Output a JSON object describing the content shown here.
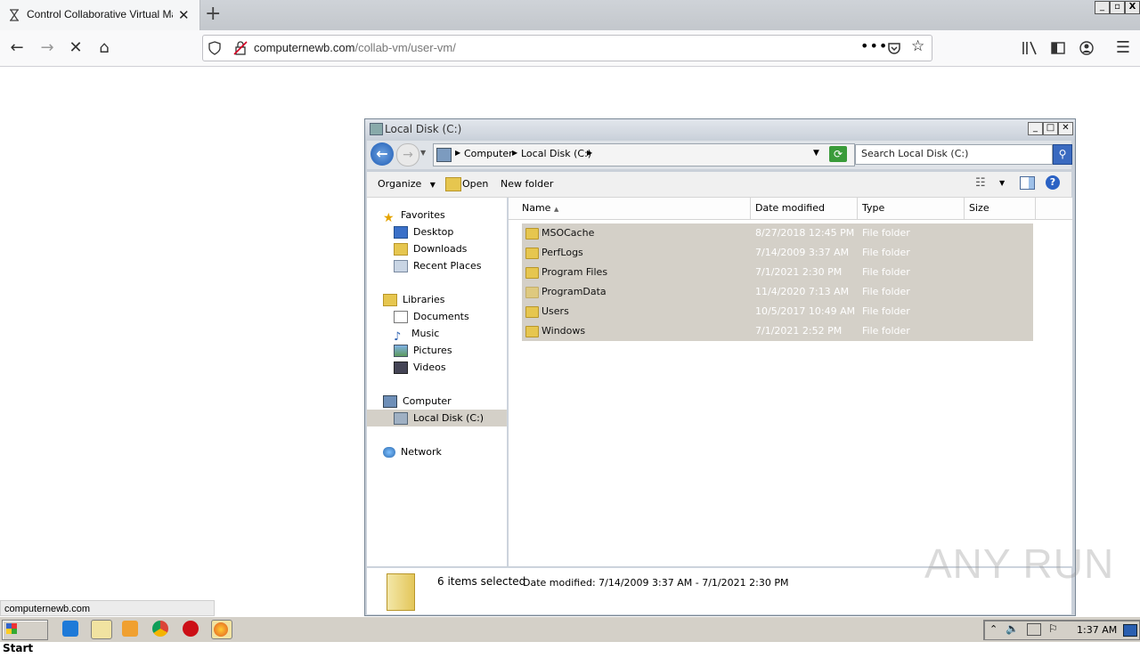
{
  "browser": {
    "tab_title": "Control Collaborative Virtual Machi",
    "url_host": "computernewb.com",
    "url_path": "/collab-vm/user-vm/",
    "status_link": "computernewb.com",
    "window_controls": [
      "_",
      "▫",
      "X"
    ]
  },
  "explorer": {
    "window_title": "Local Disk (C:)",
    "breadcrumb": [
      "Computer",
      "Local Disk (C:)"
    ],
    "search_placeholder": "Search Local Disk (C:)",
    "toolbar": {
      "organize": "Organize",
      "open": "Open",
      "new_folder": "New folder"
    },
    "nav": {
      "favorites": "Favorites",
      "favorites_items": [
        "Desktop",
        "Downloads",
        "Recent Places"
      ],
      "libraries": "Libraries",
      "libraries_items": [
        "Documents",
        "Music",
        "Pictures",
        "Videos"
      ],
      "computer": "Computer",
      "computer_items": [
        "Local Disk (C:)"
      ],
      "network": "Network"
    },
    "columns": [
      "Name",
      "Date modified",
      "Type",
      "Size"
    ],
    "files": [
      {
        "name": "MSOCache",
        "date": "8/27/2018 12:45 PM",
        "type": "File folder"
      },
      {
        "name": "PerfLogs",
        "date": "7/14/2009 3:37 AM",
        "type": "File folder"
      },
      {
        "name": "Program Files",
        "date": "7/1/2021 2:30 PM",
        "type": "File folder"
      },
      {
        "name": "ProgramData",
        "date": "11/4/2020 7:13 AM",
        "type": "File folder"
      },
      {
        "name": "Users",
        "date": "10/5/2017 10:49 AM",
        "type": "File folder"
      },
      {
        "name": "Windows",
        "date": "7/1/2021 2:52 PM",
        "type": "File folder"
      }
    ],
    "details": {
      "count": "6 items selected",
      "date_range": "Date modified: 7/14/2009 3:37 AM - 7/1/2021 2:30 PM"
    }
  },
  "taskbar": {
    "start": "Start",
    "clock": "1:37 AM"
  },
  "watermark": "ANY RUN"
}
